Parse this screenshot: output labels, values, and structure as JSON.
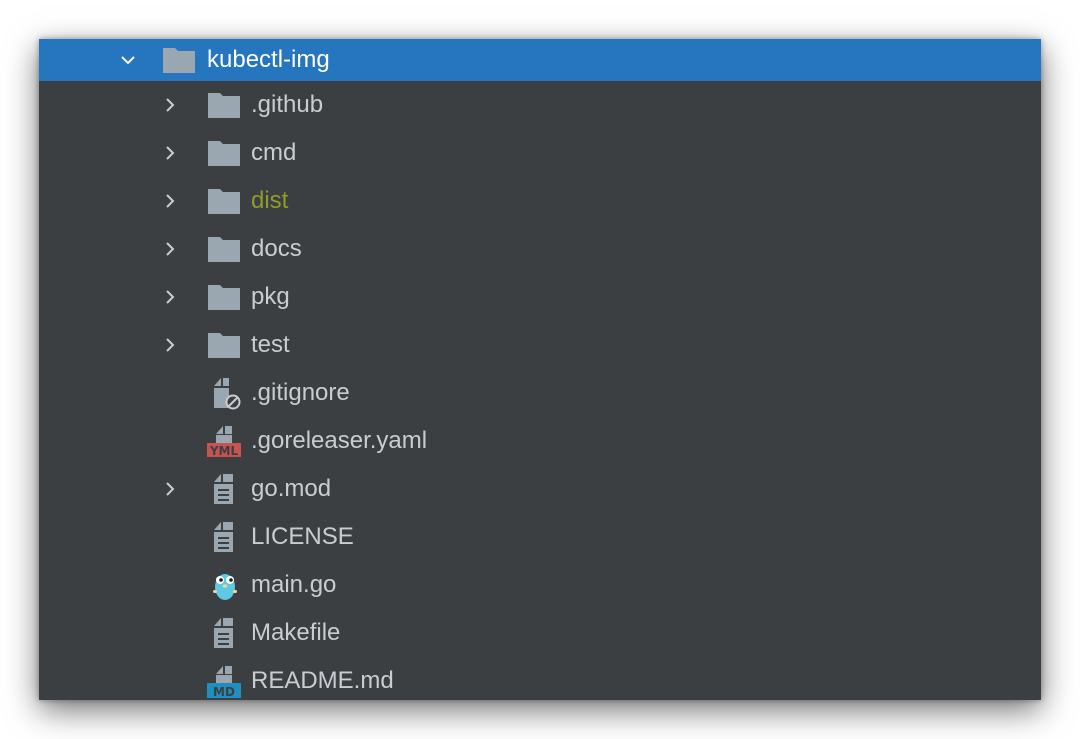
{
  "tree": {
    "root": {
      "label": "kubectl-img",
      "expanded": true,
      "icon": "folder-icon"
    },
    "items": [
      {
        "label": ".github",
        "kind": "folder",
        "expandable": true,
        "icon": "folder-icon"
      },
      {
        "label": "cmd",
        "kind": "folder",
        "expandable": true,
        "icon": "folder-icon"
      },
      {
        "label": "dist",
        "kind": "folder",
        "expandable": true,
        "icon": "folder-icon",
        "color": "#8f9b2b"
      },
      {
        "label": "docs",
        "kind": "folder",
        "expandable": true,
        "icon": "folder-icon"
      },
      {
        "label": "pkg",
        "kind": "folder",
        "expandable": true,
        "icon": "folder-icon"
      },
      {
        "label": "test",
        "kind": "folder",
        "expandable": true,
        "icon": "folder-icon"
      },
      {
        "label": ".gitignore",
        "kind": "file",
        "expandable": false,
        "icon": "ignored-file-icon"
      },
      {
        "label": ".goreleaser.yaml",
        "kind": "file",
        "expandable": false,
        "icon": "yaml-file-icon",
        "badge": "YML"
      },
      {
        "label": "go.mod",
        "kind": "file",
        "expandable": true,
        "icon": "text-file-icon"
      },
      {
        "label": "LICENSE",
        "kind": "file",
        "expandable": false,
        "icon": "text-file-icon"
      },
      {
        "label": "main.go",
        "kind": "file",
        "expandable": false,
        "icon": "gopher-icon"
      },
      {
        "label": "Makefile",
        "kind": "file",
        "expandable": false,
        "icon": "text-file-icon"
      },
      {
        "label": "README.md",
        "kind": "file",
        "expandable": false,
        "icon": "markdown-file-icon",
        "badge": "MD"
      }
    ]
  },
  "colors": {
    "panel_bg": "#3c3f41",
    "selection": "#2675bf",
    "text": "#c9cdd2",
    "folder": "#9aa7b0",
    "ignored": "#8f9b2b",
    "yaml_badge": "#c75450",
    "md_badge": "#1f8fbf"
  }
}
